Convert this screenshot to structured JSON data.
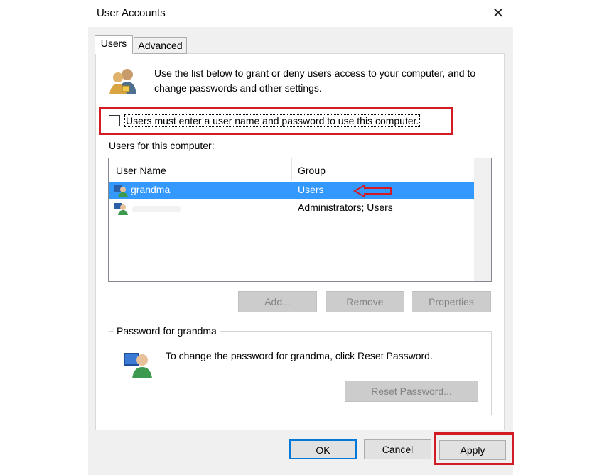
{
  "window": {
    "title": "User Accounts",
    "close_glyph": "✕"
  },
  "tabs": [
    {
      "label": "Users",
      "active": true
    },
    {
      "label": "Advanced",
      "active": false
    }
  ],
  "intro_text": "Use the list below to grant or deny users access to your computer, and to change passwords and other settings.",
  "checkbox": {
    "label": "Users must enter a user name and password to use this computer.",
    "checked": false
  },
  "users_list": {
    "label": "Users for this computer:",
    "columns": [
      "User Name",
      "Group"
    ],
    "rows": [
      {
        "name": "grandma",
        "group": "Users",
        "selected": true
      },
      {
        "name": "",
        "group": "Administrators; Users",
        "selected": false
      }
    ]
  },
  "buttons": {
    "add": "Add...",
    "remove": "Remove",
    "properties": "Properties",
    "reset": "Reset Password...",
    "ok": "OK",
    "cancel": "Cancel",
    "apply": "Apply"
  },
  "password_group": {
    "legend": "Password for grandma",
    "text": "To change the password for grandma, click Reset Password."
  },
  "colors": {
    "highlight_red": "#d31b26",
    "selection_blue": "#3399ff",
    "focus_blue": "#0078d7"
  },
  "icons": [
    "users-icon",
    "user-icon",
    "user-key-icon",
    "red-arrow-icon",
    "close-icon"
  ]
}
